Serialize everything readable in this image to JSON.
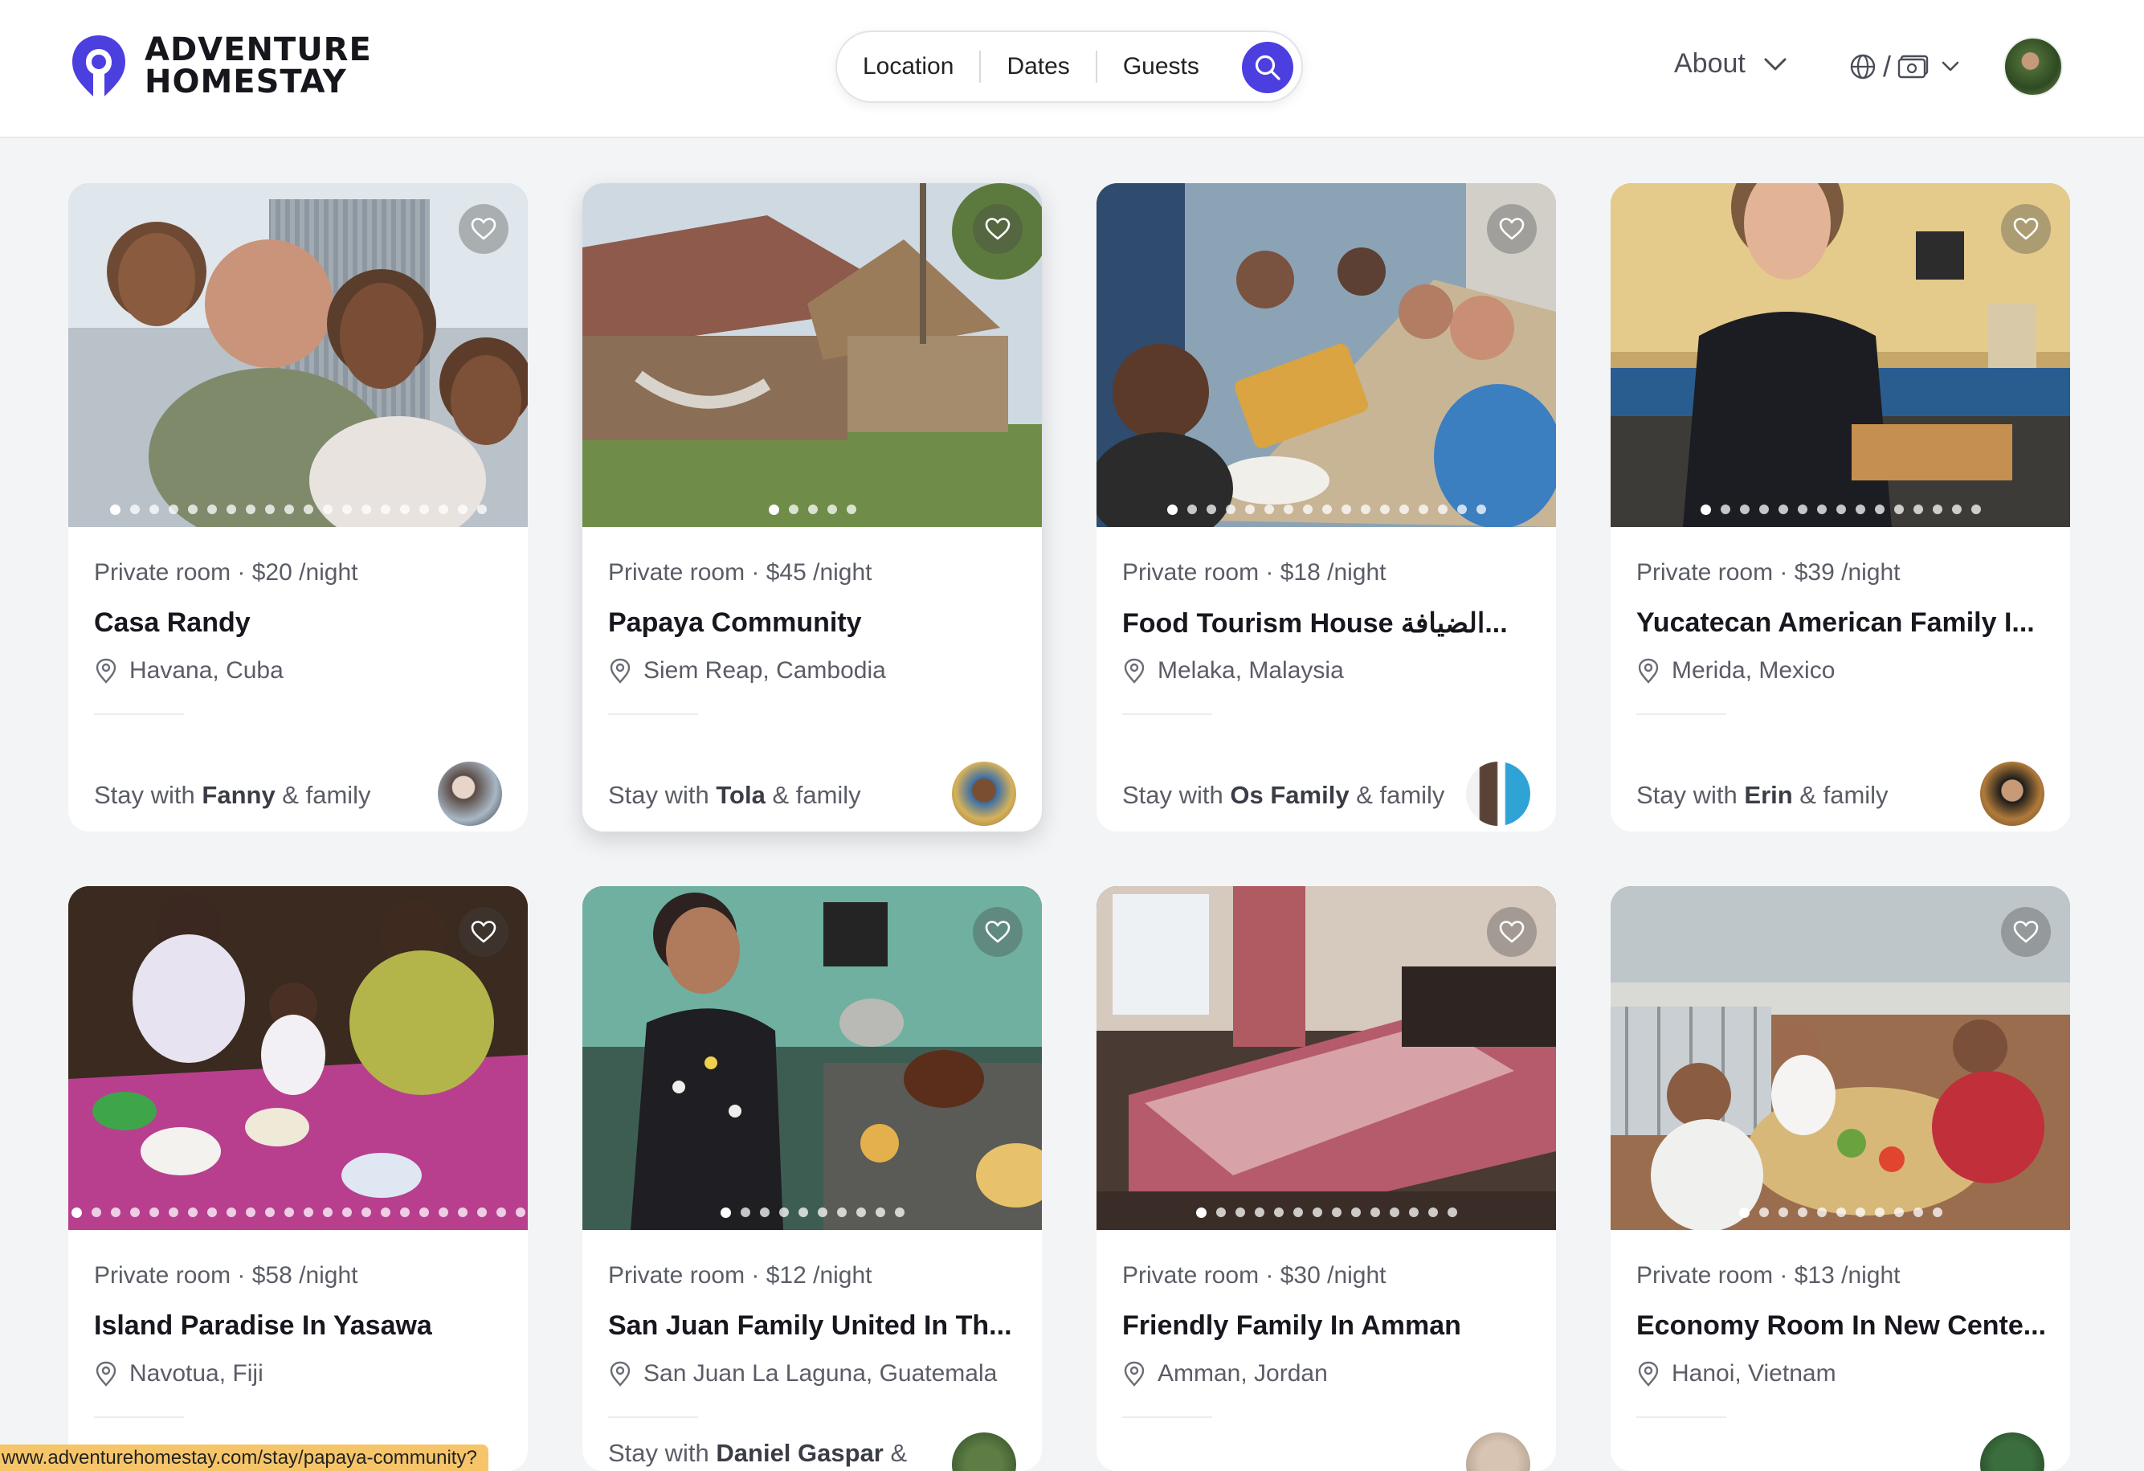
{
  "brand": {
    "line1": "ADVENTURE",
    "line2": "HOMESTAY",
    "accent": "#4c3fe0"
  },
  "search": {
    "location": "Location",
    "dates": "Dates",
    "guests": "Guests"
  },
  "nav": {
    "about": "About",
    "locale_slash": "/"
  },
  "icons": {
    "search": "search-icon",
    "heart": "heart-icon",
    "pin": "location-pin-icon",
    "globe": "globe-icon",
    "currency": "banknote-icon",
    "chevron": "chevron-down-icon"
  },
  "listings": [
    {
      "meta": "Private room · $20 /night",
      "title": "Casa Randy",
      "location": "Havana, Cuba",
      "host_prefix": "Stay with ",
      "host": "Fanny",
      "host_suffix": " & family",
      "photo_count": 20,
      "active_photo": 0
    },
    {
      "meta": "Private room · $45 /night",
      "title": "Papaya Community",
      "location": "Siem Reap, Cambodia",
      "host_prefix": "Stay with ",
      "host": "Tola",
      "host_suffix": " & family",
      "photo_count": 5,
      "active_photo": 0
    },
    {
      "meta": "Private room · $18 /night",
      "title": "Food Tourism House الضيافة...",
      "location": "Melaka, Malaysia",
      "host_prefix": "Stay with ",
      "host": "Os Family",
      "host_suffix": " & family",
      "photo_count": 17,
      "active_photo": 0
    },
    {
      "meta": "Private room · $39 /night",
      "title": "Yucatecan American Family I...",
      "location": "Merida, Mexico",
      "host_prefix": "Stay with ",
      "host": "Erin",
      "host_suffix": " & family",
      "photo_count": 15,
      "active_photo": 0
    },
    {
      "meta": "Private room · $58 /night",
      "title": "Island Paradise In Yasawa",
      "location": "Navotua, Fiji",
      "host_prefix": "",
      "host": "",
      "host_suffix": "",
      "photo_count": 24,
      "active_photo": 0
    },
    {
      "meta": "Private room · $12 /night",
      "title": "San Juan Family United In Th...",
      "location": "San Juan La Laguna, Guatemala",
      "host_prefix": "Stay with ",
      "host": "Daniel Gaspar",
      "host_suffix": " &",
      "photo_count": 10,
      "active_photo": 0
    },
    {
      "meta": "Private room · $30 /night",
      "title": "Friendly Family In Amman",
      "location": "Amman, Jordan",
      "host_prefix": "",
      "host": "",
      "host_suffix": "",
      "photo_count": 14,
      "active_photo": 0
    },
    {
      "meta": "Private room · $13 /night",
      "title": "Economy Room In New Cente...",
      "location": "Hanoi, Vietnam",
      "host_prefix": "",
      "host": "",
      "host_suffix": "",
      "photo_count": 11,
      "active_photo": 0
    }
  ],
  "status_url": "www.adventurehomestay.com/stay/papaya-community?"
}
